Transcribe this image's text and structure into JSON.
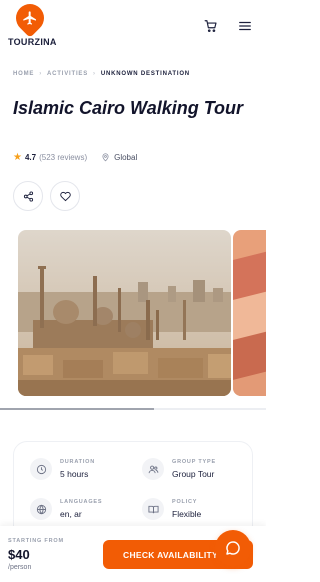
{
  "header": {
    "brand": "TOURZINA",
    "logo_icon": "airplane-icon",
    "cart_icon": "cart-icon",
    "menu_icon": "hamburger-menu-icon"
  },
  "breadcrumb": {
    "items": [
      "HOME",
      "ACTIVITIES",
      "UNKNOWN DESTINATION"
    ]
  },
  "tour": {
    "title": "Islamic Cairo Walking Tour",
    "rating": "4.7",
    "reviews": "(523 reviews)",
    "location": "Global"
  },
  "actions": {
    "share_icon": "share-icon",
    "favorite_icon": "heart-icon"
  },
  "gallery": {
    "photos": [
      "Cairo skyline with mosques",
      "Red rock canyon"
    ],
    "scroll_progress": 0.58
  },
  "details": {
    "duration": {
      "label": "DURATION",
      "value": "5 hours",
      "icon": "clock-icon"
    },
    "group_type": {
      "label": "GROUP TYPE",
      "value": "Group Tour",
      "icon": "users-icon"
    },
    "languages": {
      "label": "LANGUAGES",
      "value": "en, ar",
      "icon": "globe-icon"
    },
    "policy": {
      "label": "POLICY",
      "value": "Flexible",
      "icon": "book-icon"
    }
  },
  "booking": {
    "starting_from": "STARTING FROM",
    "price": "$40",
    "per": "/person",
    "cta_label": "CHECK AVAILABILITY",
    "chat_icon": "chat-bubble-icon"
  },
  "colors": {
    "accent": "#f25c05",
    "text_dark": "#12142b",
    "muted": "#9aa0ae",
    "star": "#f7a01c"
  }
}
